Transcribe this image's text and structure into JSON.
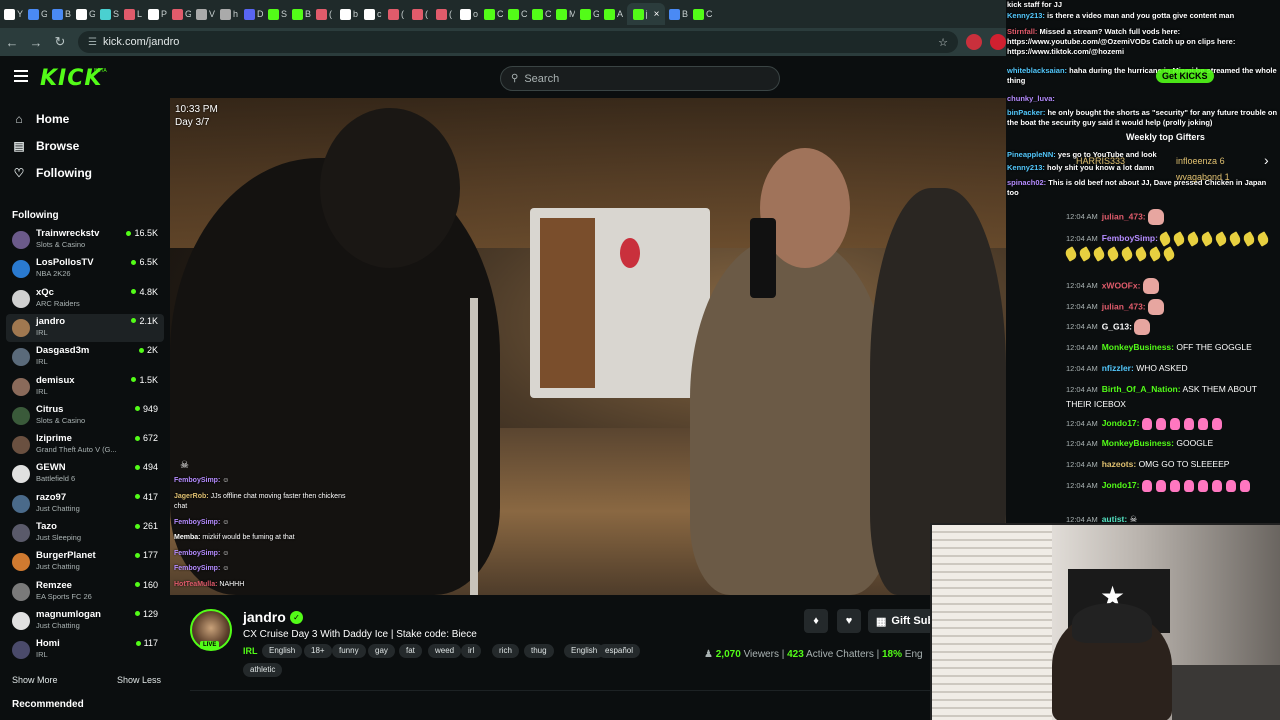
{
  "browser": {
    "tabs": [
      "Y",
      "G",
      "B",
      "G",
      "S",
      "L",
      "P",
      "G",
      "V",
      "h",
      "D",
      "S",
      "B",
      "(",
      "b",
      "c",
      "(",
      "(",
      "(",
      "o",
      "C",
      "C",
      "C",
      "M",
      "G",
      "A",
      "j",
      "B",
      "C"
    ],
    "active_tab": "jandro",
    "url": "kick.com/jandro"
  },
  "kick": {
    "logo": "KICK",
    "logo_beta": "BETA",
    "search_placeholder": "Search",
    "nav": [
      {
        "label": "Home",
        "icon": "home-icon"
      },
      {
        "label": "Browse",
        "icon": "browse-icon"
      },
      {
        "label": "Following",
        "icon": "heart-icon"
      }
    ],
    "following_heading": "Following",
    "channels": [
      {
        "name": "Trainwreckstv",
        "category": "Slots & Casino",
        "viewers": "16.5K",
        "color": "#6b5a8a"
      },
      {
        "name": "LosPollosTV",
        "category": "NBA 2K26",
        "viewers": "6.5K",
        "color": "#2a7ad0"
      },
      {
        "name": "xQc",
        "category": "ARC Raiders",
        "viewers": "4.8K",
        "color": "#d0d0d0"
      },
      {
        "name": "jandro",
        "category": "IRL",
        "viewers": "2.1K",
        "color": "#a07850"
      },
      {
        "name": "Dasgasd3m",
        "category": "IRL",
        "viewers": "2K",
        "color": "#5a6a7a"
      },
      {
        "name": "demisux",
        "category": "IRL",
        "viewers": "1.5K",
        "color": "#8a6a5a"
      },
      {
        "name": "Citrus",
        "category": "Slots & Casino",
        "viewers": "949",
        "color": "#3a5a3a"
      },
      {
        "name": "lziprime",
        "category": "Grand Theft Auto V (G...",
        "viewers": "672",
        "color": "#6a5040"
      },
      {
        "name": "GEWN",
        "category": "Battlefield 6",
        "viewers": "494",
        "color": "#e0e0e0"
      },
      {
        "name": "razo97",
        "category": "Just Chatting",
        "viewers": "417",
        "color": "#4a6a8a"
      },
      {
        "name": "Tazo",
        "category": "Just Sleeping",
        "viewers": "261",
        "color": "#5a5a6a"
      },
      {
        "name": "BurgerPlanet",
        "category": "Just Chatting",
        "viewers": "177",
        "color": "#d07a30"
      },
      {
        "name": "Remzee",
        "category": "EA Sports FC 26",
        "viewers": "160",
        "color": "#7a7a7a"
      },
      {
        "name": "magnumlogan",
        "category": "Just Chatting",
        "viewers": "129",
        "color": "#e0e0e0"
      },
      {
        "name": "Homi",
        "category": "IRL",
        "viewers": "117",
        "color": "#4a4a6a"
      }
    ],
    "show_more": "Show More",
    "show_less": "Show Less",
    "recommended": "Recommended"
  },
  "video": {
    "time": "10:33 PM",
    "day": "Day 3/7",
    "overlay_chat": [
      {
        "user": "FemboySimp:",
        "text": "",
        "tone": "purple"
      },
      {
        "user": "JagerRob:",
        "text": "JJs offline chat moving faster then chickens chat",
        "tone": "gold"
      },
      {
        "user": "FemboySimp:",
        "text": "",
        "tone": "purple"
      },
      {
        "user": "Memba:",
        "text": "mizkif would be fuming at that",
        "tone": "white"
      },
      {
        "user": "FemboySimp:",
        "text": "",
        "tone": "purple"
      },
      {
        "user": "FemboySimp:",
        "text": "",
        "tone": "purple"
      },
      {
        "user": "HotTeaMulla:",
        "text": "NAHHH",
        "tone": "red"
      }
    ]
  },
  "stream": {
    "streamer": "jandro",
    "live_badge": "LIVE",
    "title": "CX Cruise Day 3 With Daddy Ice | Stake code: Biece",
    "category": "IRL",
    "tags": [
      "English",
      "18+",
      "funny",
      "gay",
      "fat",
      "weed",
      "irl",
      "rich",
      "thug",
      "English",
      "español",
      "athletic"
    ],
    "gift_label": "Gift Sub",
    "viewers": "2,070",
    "viewers_label": "Viewers",
    "chatters": "423",
    "chatters_label": "Active Chatters",
    "english_pct": "18%",
    "english_label": "Eng"
  },
  "right_overlay": {
    "lines": [
      {
        "user": "",
        "text": "kick staff for JJ",
        "tone": ""
      },
      {
        "user": "Kenny213:",
        "text": "is there a video man and you gotta give content man",
        "tone": "blue"
      },
      {
        "user": "Stirnfall:",
        "text": "Missed a stream? Watch full vods here: https://www.youtube.com/@OzemiVODs Catch up on clips here: https://www.tiktok.com/@hozemi",
        "tone": "red"
      },
      {
        "user": "whiteblacksaian:",
        "text": "haha during the hurricane in Miami he streamed the whole thing",
        "tone": "blue"
      },
      {
        "user": "chunky_luva:",
        "text": "",
        "tone": "purple"
      },
      {
        "user": "binPacker:",
        "text": "he only bought the shorts as \"security\" for any future trouble on the boat the security guy said it would help (prolly joking)",
        "tone": "blue"
      },
      {
        "user": "PineappleNN:",
        "text": "yes go to YouTube and look",
        "tone": "blue"
      },
      {
        "user": "Kenny213:",
        "text": "holy shit you know a lot damn",
        "tone": "blue"
      },
      {
        "user": "spinach02:",
        "text": "This is old beef not about JJ, Dave pressed Chicken in Japan too",
        "tone": "purple"
      }
    ],
    "get_kicks": "Get KICKS",
    "weekly_top": "Weekly top Gifters",
    "gifters": [
      {
        "name": "HARRIS333",
        "count": ""
      },
      {
        "name": "infloeenza",
        "count": "6"
      },
      {
        "name": "wvagabond",
        "count": "1"
      }
    ]
  },
  "chat": [
    {
      "time": "12:04 AM",
      "user": "julian_473:",
      "text": "",
      "tone": "red",
      "emotes": "face1"
    },
    {
      "time": "12:04 AM",
      "user": "FemboySimp:",
      "text": "",
      "tone": "purple",
      "emotes": "ban16"
    },
    {
      "time": "12:04 AM",
      "user": "xWOOFx:",
      "text": "",
      "tone": "red",
      "emotes": "face1"
    },
    {
      "time": "12:04 AM",
      "user": "julian_473:",
      "text": "",
      "tone": "red",
      "emotes": "face1"
    },
    {
      "time": "12:04 AM",
      "user": "G_G13:",
      "text": "",
      "tone": "white",
      "emotes": "face1"
    },
    {
      "time": "12:04 AM",
      "user": "MonkeyBusiness:",
      "text": "OFF THE GOGGLE",
      "tone": "green",
      "emotes": ""
    },
    {
      "time": "12:04 AM",
      "user": "nfizzler:",
      "text": "WHO ASKED",
      "tone": "blue",
      "emotes": ""
    },
    {
      "time": "12:04 AM",
      "user": "Birth_Of_A_Nation:",
      "text": "ASK THEM ABOUT THEIR ICEBOX",
      "tone": "green",
      "emotes": ""
    },
    {
      "time": "12:04 AM",
      "user": "Jondo17:",
      "text": "",
      "tone": "green",
      "emotes": "pink6"
    },
    {
      "time": "12:04 AM",
      "user": "MonkeyBusiness:",
      "text": "GOOGLE",
      "tone": "green",
      "emotes": ""
    },
    {
      "time": "12:04 AM",
      "user": "hazeots:",
      "text": "OMG GO TO SLEEEEP",
      "tone": "yellow",
      "emotes": ""
    },
    {
      "time": "12:04 AM",
      "user": "Jondo17:",
      "text": "",
      "tone": "green",
      "emotes": "pink8"
    },
    {
      "time": "12:04 AM",
      "user": "autist:",
      "text": "",
      "tone": "teal",
      "emotes": ""
    }
  ]
}
